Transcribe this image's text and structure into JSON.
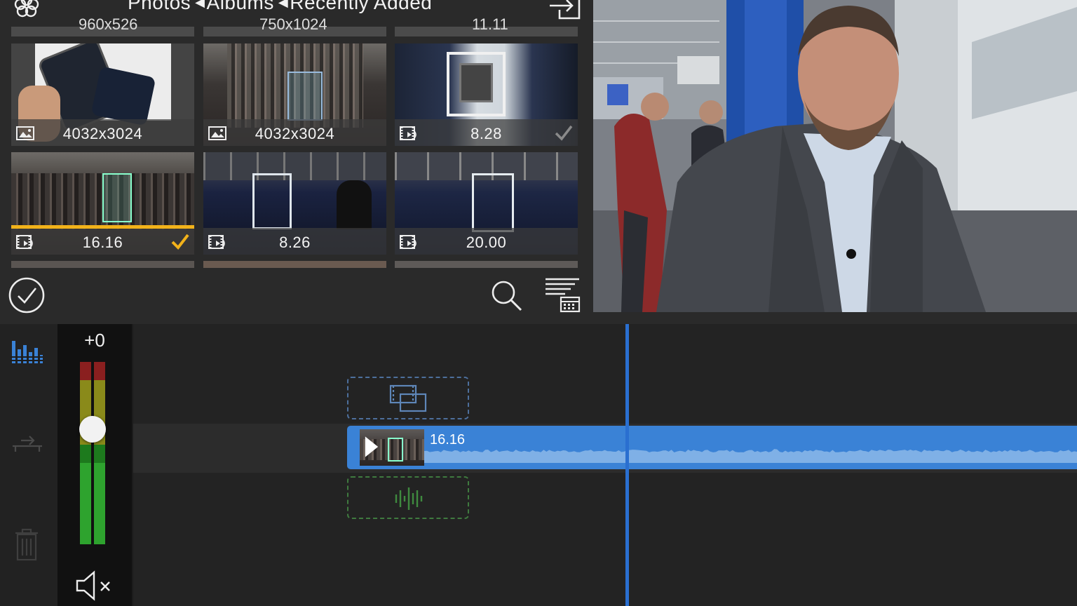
{
  "header": {
    "breadcrumb": [
      "Photos",
      "Albums",
      "Recently Added"
    ],
    "logo_icon": "flower-logo-icon",
    "export_icon": "export-icon"
  },
  "top_row_partial": [
    "960x526",
    "750x1024",
    "11.11"
  ],
  "media_grid": [
    {
      "caption": "4032x3024",
      "kind": "photo",
      "selected": false,
      "checked": false
    },
    {
      "caption": "4032x3024",
      "kind": "photo",
      "selected": false,
      "checked": false
    },
    {
      "caption": "8.28",
      "kind": "video",
      "selected": false,
      "checked": true
    },
    {
      "caption": "16.16",
      "kind": "video",
      "selected": true,
      "checked": true
    },
    {
      "caption": "8.26",
      "kind": "video",
      "selected": false,
      "checked": false
    },
    {
      "caption": "20.00",
      "kind": "video",
      "selected": false,
      "checked": false
    }
  ],
  "browser_toolbar": {
    "select_icon": "checkmark-circle-icon",
    "search_icon": "search-icon",
    "sort_icon": "sort-by-date-icon"
  },
  "mixer": {
    "gain": "+0",
    "volume_level": 0.62,
    "meter_level": 0.45,
    "mute_icon": "speaker-mute-icon"
  },
  "left_rail": {
    "icons": [
      "audio-levels-icon",
      "track-split-icon",
      "trash-icon"
    ]
  },
  "timeline": {
    "clip_label": "16.16",
    "playhead_position": 0.52
  },
  "colors": {
    "accent": "#3a82d6",
    "selection": "#f2b21a",
    "meter_green": "#2ea32e",
    "meter_yellow": "#8a8a1a",
    "meter_red": "#8a1f1f",
    "audio_dropzone": "#3f7a3f",
    "video_dropzone": "#4d6f9c"
  }
}
